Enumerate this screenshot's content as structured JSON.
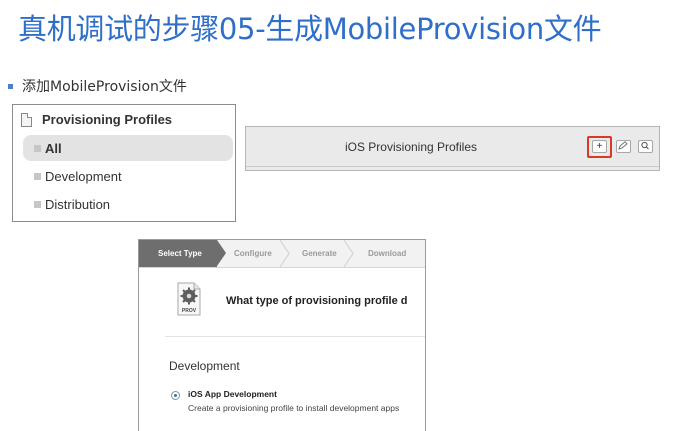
{
  "slide": {
    "title": "真机调试的步骤05-生成MobileProvision文件",
    "bullet": "添加MobileProvision文件"
  },
  "sidebar": {
    "header": "Provisioning Profiles",
    "items": [
      {
        "label": "All",
        "selected": true
      },
      {
        "label": "Development",
        "selected": false
      },
      {
        "label": "Distribution",
        "selected": false
      }
    ]
  },
  "toolbar": {
    "title": "iOS Provisioning Profiles",
    "add_label": "+",
    "edit_icon": "pencil-icon",
    "search_icon": "search-icon",
    "highlight_color": "#d83a2a"
  },
  "wizard": {
    "steps": [
      "Select Type",
      "Configure",
      "Generate",
      "Download"
    ],
    "active_step": "Select Type",
    "icon_label": "PROV",
    "question": "What type of provisioning profile d",
    "section_title": "Development",
    "option_label": "iOS App Development",
    "option_desc": "Create a provisioning profile to install development apps",
    "option_selected": true
  },
  "colors": {
    "title_blue": "#2f6fc9",
    "step_active": "#6e6e6e"
  }
}
